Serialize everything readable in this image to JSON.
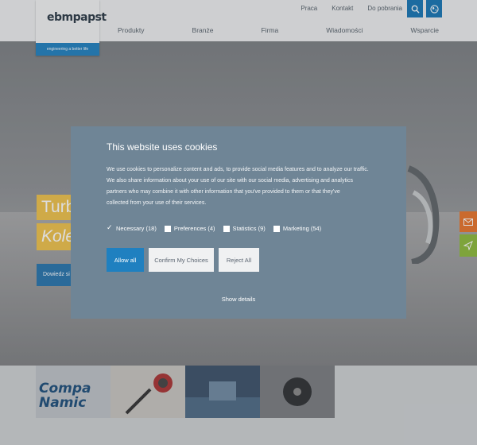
{
  "header": {
    "logo_text": "ebmpapst",
    "logo_tagline": "engineering a better life",
    "top_links": [
      "Praca",
      "Kontakt",
      "Do pobrania"
    ],
    "nav": [
      "Produkty",
      "Branże",
      "Firma",
      "Wiadomości",
      "Wsparcie"
    ]
  },
  "hero": {
    "title_line1": "Turb",
    "title_line2": "Kole",
    "button_label": "Dowiedz si"
  },
  "tiles": {
    "tile1_text": "Compa Namic"
  },
  "cookie_dialog": {
    "title": "This website uses cookies",
    "body_line1": "We use cookies to personalize content and ads, to provide social media features and to analyze our traffic.",
    "body_line2": "We also share information about your use of our site with our social media, advertising and analytics",
    "body_line3": "partners who may combine it with other information that you've provided to them or that they've",
    "body_line4": "collected from your use of their services.",
    "checkboxes": [
      {
        "label": "Necessary (18)",
        "checked": true
      },
      {
        "label": "Preferences (4)",
        "checked": false
      },
      {
        "label": "Statistics (9)",
        "checked": false
      },
      {
        "label": "Marketing (54)",
        "checked": false
      }
    ],
    "allow_all": "Allow all",
    "confirm": "Confirm My Choices",
    "reject": "Reject All",
    "show_details": "Show details"
  },
  "colors": {
    "brand_blue": "#1f80c0",
    "dialog_bg": "#6f8596",
    "accent_yellow": "#f0c24a",
    "mail_orange": "#e9742a",
    "send_green": "#8dbb3a"
  }
}
